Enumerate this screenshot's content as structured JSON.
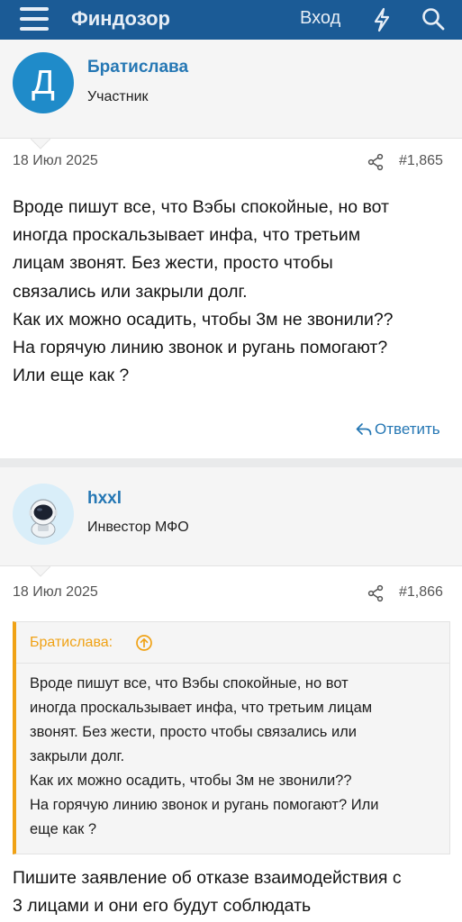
{
  "header": {
    "brand": "Финдозор",
    "login_label": "Вход"
  },
  "posts": [
    {
      "avatar_letter": "Д",
      "username": "Братислава",
      "user_title": "Участник",
      "date": "18 Июл 2025",
      "number": "#1,865",
      "lines": [
        "Вроде пишут все, что Вэбы спокойные, но вот",
        "иногда проскальзывает инфа, что третьим",
        "лицам звонят. Без жести, просто чтобы",
        "связались или закрыли долг.",
        "Как их можно осадить, чтобы 3м не звонили??",
        "На горячую линию звонок и ругань помогают?",
        "Или еще как ?"
      ],
      "reply_label": "Ответить"
    },
    {
      "username": "hxxl",
      "user_title": "Инвестор МФО",
      "date": "18 Июл 2025",
      "number": "#1,866",
      "quote": {
        "author": "Братислава:",
        "lines": [
          "Вроде пишут все, что Вэбы спокойные, но вот",
          "иногда проскальзывает инфа, что третьим лицам",
          "звонят. Без жести, просто чтобы связались или",
          "закрыли долг.",
          "Как их можно осадить, чтобы 3м не звонили??",
          "На горячую линию звонок и ругань помогают? Или",
          "еще как ?"
        ]
      },
      "lines": [
        "Пишите заявление об отказе взаимодействия с",
        "3 лицами и они его будут соблюдать"
      ]
    }
  ],
  "colors": {
    "header_bg": "#1b5b96",
    "link": "#2577b4",
    "quote_accent": "#f0a215",
    "avatar_bg": "#1f8bc9"
  },
  "icons": [
    "menu-icon",
    "bolt-icon",
    "search-icon",
    "share-icon",
    "reply-icon",
    "arrow-up-circle-icon",
    "astronaut-icon"
  ]
}
